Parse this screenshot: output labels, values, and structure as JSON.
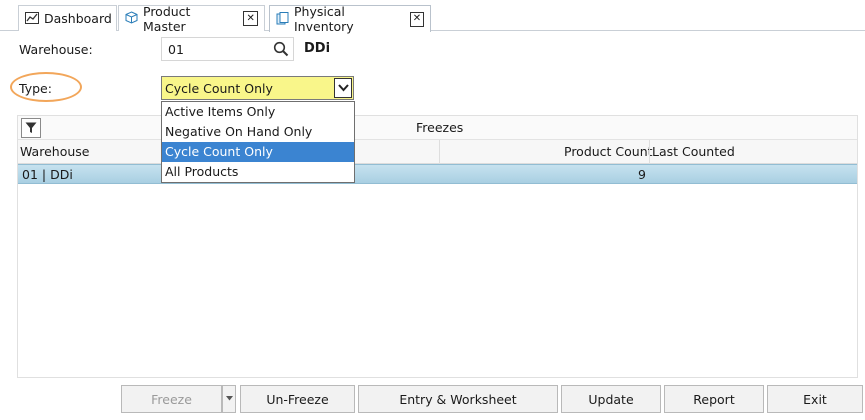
{
  "tabs": [
    {
      "label": "Dashboard",
      "icon": "dashboard-icon"
    },
    {
      "label": "Product Master",
      "icon": "cube-icon",
      "close": "✕"
    },
    {
      "label": "Physical Inventory",
      "icon": "document-icon",
      "close": "✕"
    }
  ],
  "form": {
    "warehouse_label": "Warehouse:",
    "warehouse_value": "01",
    "warehouse_desc": "DDi",
    "type_label": "Type:",
    "type_value": "Cycle Count Only"
  },
  "dropdown": {
    "options": [
      "Active Items Only",
      "Negative On Hand Only",
      "Cycle Count Only",
      "All Products"
    ],
    "selected_index": 2
  },
  "grid": {
    "title": "Freezes",
    "columns": [
      "Warehouse",
      "Product Count",
      "Last Counted"
    ],
    "rows": [
      {
        "warehouse": "01 | DDi",
        "product_count": "9",
        "last_counted": ""
      }
    ]
  },
  "buttons": {
    "freeze": "Freeze",
    "unfreeze": "Un-Freeze",
    "entry_worksheet": "Entry & Worksheet",
    "update": "Update",
    "report": "Report",
    "exit": "Exit"
  },
  "colors": {
    "select_bg": "#f9f68a",
    "selected_option": "#3b84d1",
    "row_highlight": "#b6d8e8",
    "annotation_oval": "#f2a65a"
  }
}
